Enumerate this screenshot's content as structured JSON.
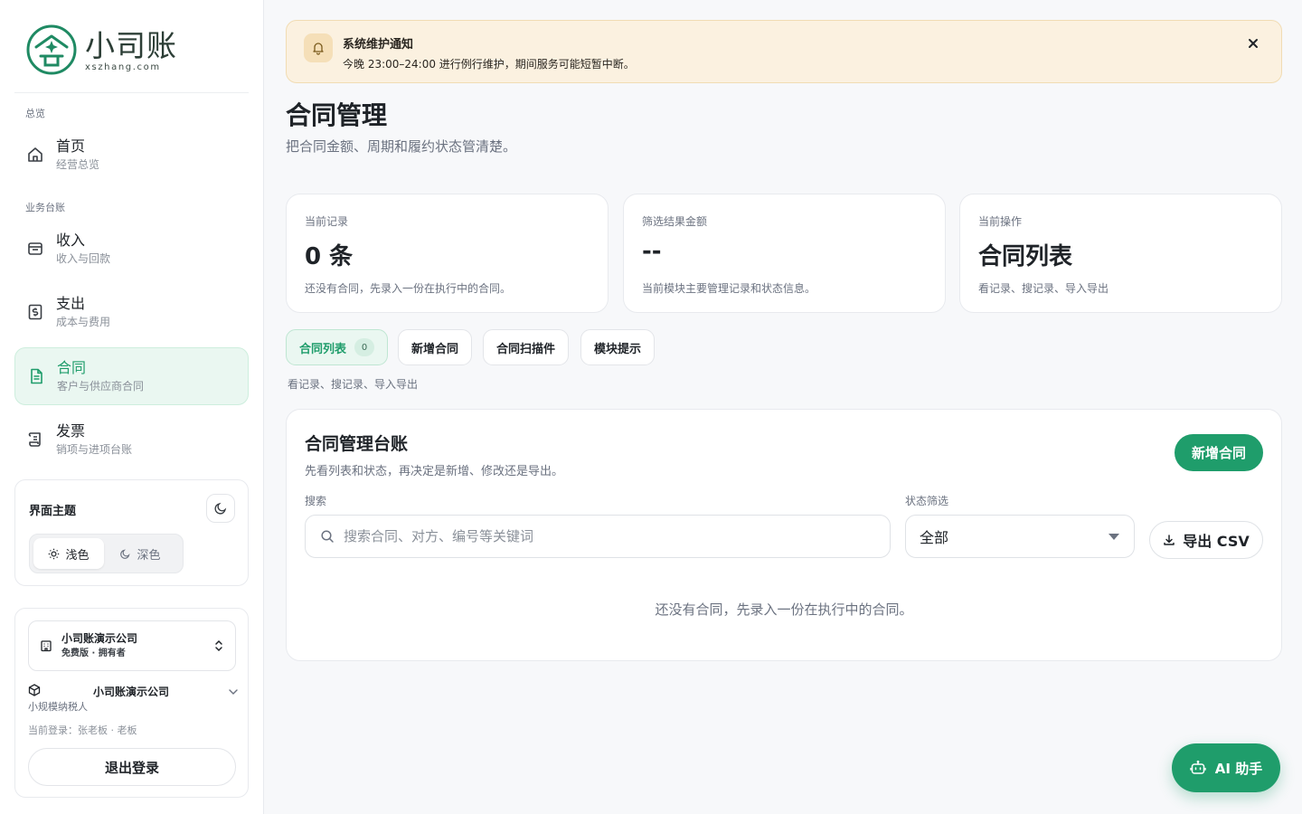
{
  "brand": {
    "name": "小司账",
    "domain": "xszhang.com"
  },
  "sidebar": {
    "section_overview": "总览",
    "section_business": "业务台账",
    "items": [
      {
        "title": "首页",
        "sub": "经营总览",
        "icon": "home-icon"
      },
      {
        "title": "收入",
        "sub": "收入与回款",
        "icon": "inbox-icon"
      },
      {
        "title": "支出",
        "sub": "成本与费用",
        "icon": "receipt-dollar-icon"
      },
      {
        "title": "合同",
        "sub": "客户与供应商合同",
        "icon": "document-icon",
        "active": true
      },
      {
        "title": "发票",
        "sub": "销项与进项台账",
        "icon": "scroll-icon"
      }
    ],
    "theme": {
      "title": "界面主题",
      "light": "浅色",
      "dark": "深色",
      "selected": "light"
    },
    "account": {
      "org_name": "小司账演示公司",
      "org_plan": "免费版 · 拥有者",
      "workspace_name": "小司账演示公司",
      "workspace_type": "小规模纳税人",
      "login_info": "当前登录：张老板 · 老板",
      "logout": "退出登录"
    }
  },
  "notice": {
    "title": "系统维护通知",
    "text": "今晚 23:00–24:00 进行例行维护，期间服务可能短暂中断。"
  },
  "page": {
    "title": "合同管理",
    "subtitle": "把合同金额、周期和履约状态管清楚。"
  },
  "stats": [
    {
      "label": "当前记录",
      "value": "0 条",
      "desc": "还没有合同，先录入一份在执行中的合同。"
    },
    {
      "label": "筛选结果金额",
      "value": "--",
      "desc": "当前模块主要管理记录和状态信息。"
    },
    {
      "label": "当前操作",
      "value": "合同列表",
      "desc": "看记录、搜记录、导入导出"
    }
  ],
  "tabs": [
    {
      "label": "合同列表",
      "count": "0",
      "active": true
    },
    {
      "label": "新增合同"
    },
    {
      "label": "合同扫描件"
    },
    {
      "label": "模块提示"
    }
  ],
  "tab_hint": "看记录、搜记录、导入导出",
  "ledger": {
    "title": "合同管理台账",
    "subtitle": "先看列表和状态，再决定是新增、修改还是导出。",
    "add_button": "新增合同",
    "search_label": "搜索",
    "search_placeholder": "搜索合同、对方、编号等关键词",
    "status_label": "状态筛选",
    "status_value": "全部",
    "export_button": "导出 CSV",
    "empty": "还没有合同，先录入一份在执行中的合同。"
  },
  "ai_button": "AI 助手",
  "colors": {
    "accent": "#1f9d6b",
    "notice_bg": "#fbf1e0"
  }
}
